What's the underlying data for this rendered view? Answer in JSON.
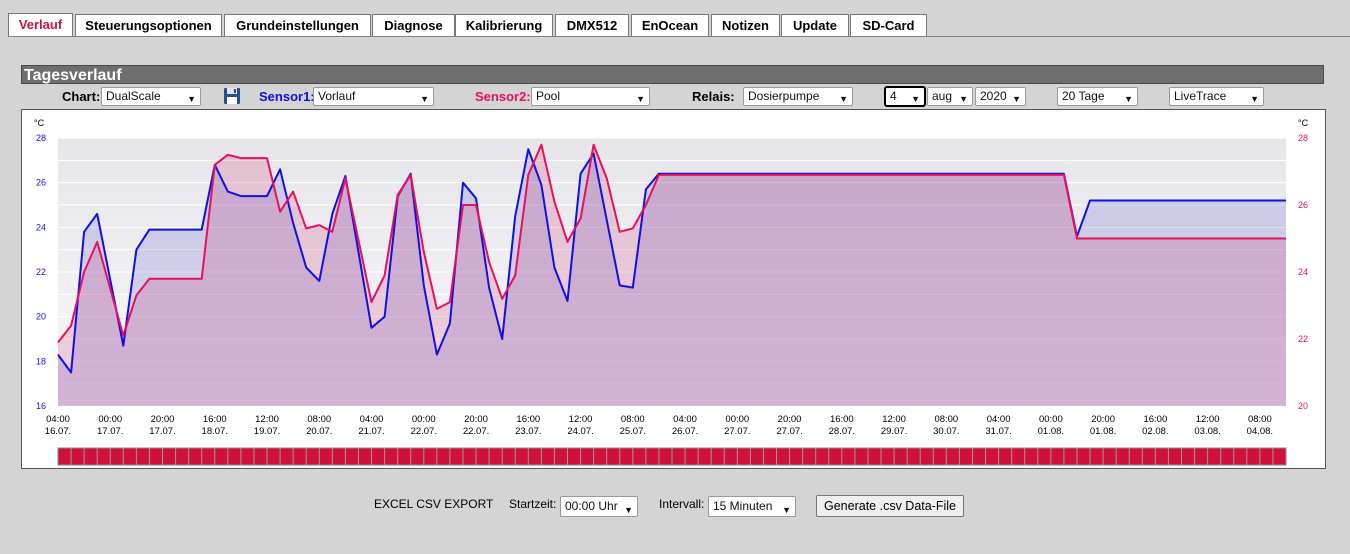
{
  "tabs": [
    "Verlauf",
    "Steuerungsoptionen",
    "Grundeinstellungen",
    "Diagnose",
    "Kalibrierung",
    "DMX512",
    "EnOcean",
    "Notizen",
    "Update",
    "SD-Card"
  ],
  "section_title": "Tagesverlauf",
  "controls": {
    "chart_label": "Chart:",
    "chart_value": "DualScale",
    "sensor1_label": "Sensor1:",
    "sensor1_value": "Vorlauf",
    "sensor2_label": "Sensor2:",
    "sensor2_value": "Pool",
    "relais_label": "Relais:",
    "relais_value": "Dosierpumpe",
    "day": "4",
    "month": "aug",
    "year": "2020",
    "range": "20 Tage",
    "mode": "LiveTrace"
  },
  "colors": {
    "sensor1": "#1010e0",
    "sensor2": "#e8105a",
    "relay": "#d0103c",
    "active_tab": "#c8103c"
  },
  "chart_data": {
    "type": "line",
    "unit_left": "°C",
    "unit_right": "°C",
    "ylim_left": [
      16,
      28
    ],
    "yticks_left": [
      16,
      18,
      20,
      22,
      24,
      26,
      28
    ],
    "ylim_right": [
      20,
      28
    ],
    "yticks_right": [
      20,
      22,
      24,
      26,
      28
    ],
    "xlim": [
      0,
      47
    ],
    "x_ticks": [
      {
        "t": "04:00",
        "d": "16.07."
      },
      {
        "t": "00:00",
        "d": "17.07."
      },
      {
        "t": "20:00",
        "d": "17.07."
      },
      {
        "t": "16:00",
        "d": "18.07."
      },
      {
        "t": "12:00",
        "d": "19.07."
      },
      {
        "t": "08:00",
        "d": "20.07."
      },
      {
        "t": "04:00",
        "d": "21.07."
      },
      {
        "t": "00:00",
        "d": "22.07."
      },
      {
        "t": "20:00",
        "d": "22.07."
      },
      {
        "t": "16:00",
        "d": "23.07."
      },
      {
        "t": "12:00",
        "d": "24.07."
      },
      {
        "t": "08:00",
        "d": "25.07."
      },
      {
        "t": "04:00",
        "d": "26.07."
      },
      {
        "t": "00:00",
        "d": "27.07."
      },
      {
        "t": "20:00",
        "d": "27.07."
      },
      {
        "t": "16:00",
        "d": "28.07."
      },
      {
        "t": "12:00",
        "d": "29.07."
      },
      {
        "t": "08:00",
        "d": "30.07."
      },
      {
        "t": "04:00",
        "d": "31.07."
      },
      {
        "t": "00:00",
        "d": "01.08."
      },
      {
        "t": "20:00",
        "d": "01.08."
      },
      {
        "t": "16:00",
        "d": "02.08."
      },
      {
        "t": "12:00",
        "d": "03.08."
      },
      {
        "t": "08:00",
        "d": "04.08."
      }
    ],
    "series": [
      {
        "name": "Sensor1",
        "axis": "left",
        "points": [
          [
            0,
            18.3
          ],
          [
            0.5,
            17.5
          ],
          [
            1,
            23.8
          ],
          [
            1.5,
            24.6
          ],
          [
            2.5,
            18.7
          ],
          [
            3,
            23
          ],
          [
            3.5,
            23.9
          ],
          [
            5.5,
            23.9
          ],
          [
            6,
            26.8
          ],
          [
            6.5,
            25.6
          ],
          [
            7,
            25.4
          ],
          [
            8,
            25.4
          ],
          [
            8.5,
            26.6
          ],
          [
            9,
            24.2
          ],
          [
            9.5,
            22.2
          ],
          [
            10,
            21.6
          ],
          [
            10.5,
            24.6
          ],
          [
            11,
            26.3
          ],
          [
            12,
            19.5
          ],
          [
            12.5,
            20
          ],
          [
            13,
            25.4
          ],
          [
            13.5,
            26.4
          ],
          [
            14,
            21.4
          ],
          [
            14.5,
            18.3
          ],
          [
            15,
            19.7
          ],
          [
            15.5,
            26
          ],
          [
            16,
            25.3
          ],
          [
            16.5,
            21.3
          ],
          [
            17,
            19
          ],
          [
            17.5,
            24.5
          ],
          [
            18,
            27.5
          ],
          [
            18.5,
            25.9
          ],
          [
            19,
            22.2
          ],
          [
            19.5,
            20.7
          ],
          [
            20,
            26.4
          ],
          [
            20.5,
            27.3
          ],
          [
            21.5,
            21.4
          ],
          [
            22,
            21.3
          ],
          [
            22.5,
            25.7
          ],
          [
            23,
            26.4
          ],
          [
            38.5,
            26.4
          ],
          [
            39,
            23.6
          ],
          [
            39.5,
            25.2
          ],
          [
            47,
            25.2
          ]
        ]
      },
      {
        "name": "Sensor2",
        "axis": "right",
        "points": [
          [
            0,
            21.9
          ],
          [
            0.5,
            22.4
          ],
          [
            1,
            24
          ],
          [
            1.5,
            24.9
          ],
          [
            2.5,
            22.1
          ],
          [
            3,
            23.3
          ],
          [
            3.5,
            23.8
          ],
          [
            5.5,
            23.8
          ],
          [
            6,
            27.2
          ],
          [
            6.5,
            27.5
          ],
          [
            7,
            27.4
          ],
          [
            8,
            27.4
          ],
          [
            8.5,
            25.8
          ],
          [
            9,
            26.4
          ],
          [
            9.5,
            25.3
          ],
          [
            10,
            25.4
          ],
          [
            10.5,
            25.2
          ],
          [
            11,
            26.8
          ],
          [
            12,
            23.1
          ],
          [
            12.5,
            23.9
          ],
          [
            13,
            26.3
          ],
          [
            13.5,
            26.9
          ],
          [
            14,
            24.6
          ],
          [
            14.5,
            22.9
          ],
          [
            15,
            23.1
          ],
          [
            15.5,
            26
          ],
          [
            16,
            26
          ],
          [
            16.5,
            24.3
          ],
          [
            17,
            23.2
          ],
          [
            17.5,
            23.9
          ],
          [
            18,
            26.9
          ],
          [
            18.5,
            27.8
          ],
          [
            19,
            26.1
          ],
          [
            19.5,
            24.9
          ],
          [
            20,
            25.6
          ],
          [
            20.5,
            27.8
          ],
          [
            21,
            26.8
          ],
          [
            21.5,
            25.2
          ],
          [
            22,
            25.3
          ],
          [
            22.5,
            26
          ],
          [
            23,
            26.9
          ],
          [
            38.5,
            26.9
          ],
          [
            39,
            25
          ],
          [
            47,
            25
          ]
        ]
      }
    ]
  },
  "export": {
    "title": "EXCEL CSV EXPORT",
    "start_label": "Startzeit:",
    "start_value": "00:00 Uhr",
    "interval_label": "Intervall:",
    "interval_value": "15 Minuten",
    "button": "Generate .csv Data-File"
  }
}
